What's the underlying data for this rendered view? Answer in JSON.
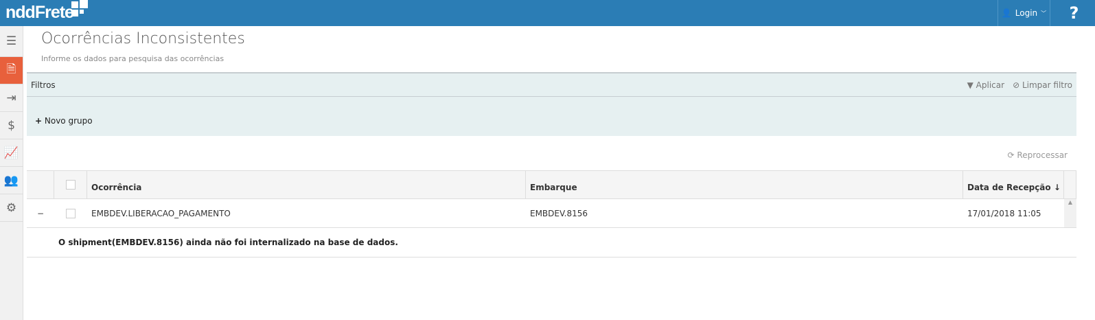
{
  "header": {
    "logo": "nddFrete",
    "login_label": "Login",
    "help_label": "?"
  },
  "sidebar": {
    "items": [
      "menu-icon",
      "documents-check-icon",
      "export-icon",
      "payment-icon",
      "report-chart-icon",
      "users-icon",
      "settings-icon"
    ],
    "active_index": 1
  },
  "page": {
    "title": "Ocorrências Inconsistentes",
    "subtitle": "Informe os dados para pesquisa das ocorrências"
  },
  "filters": {
    "title": "Filtros",
    "apply_label": "Aplicar",
    "clear_label": "Limpar filtro",
    "new_group_label": "Novo grupo"
  },
  "actions": {
    "reprocess_label": "Reprocessar"
  },
  "table": {
    "columns": [
      "Ocorrência",
      "Embarque",
      "Data de Recepção ↓"
    ],
    "rows": [
      {
        "ocorrencia": "EMBDEV.LIBERACAO_PAGAMENTO",
        "embarque": "EMBDEV.8156",
        "data": "17/01/2018 11:05",
        "expanded_symbol": "−",
        "detail": "O shipment(EMBDEV.8156) ainda não foi internalizado na base de dados."
      }
    ]
  },
  "colors": {
    "topbar": "#2b7db5",
    "active_sidebar": "#e8603c",
    "filter_bg": "#e6f0f1"
  }
}
